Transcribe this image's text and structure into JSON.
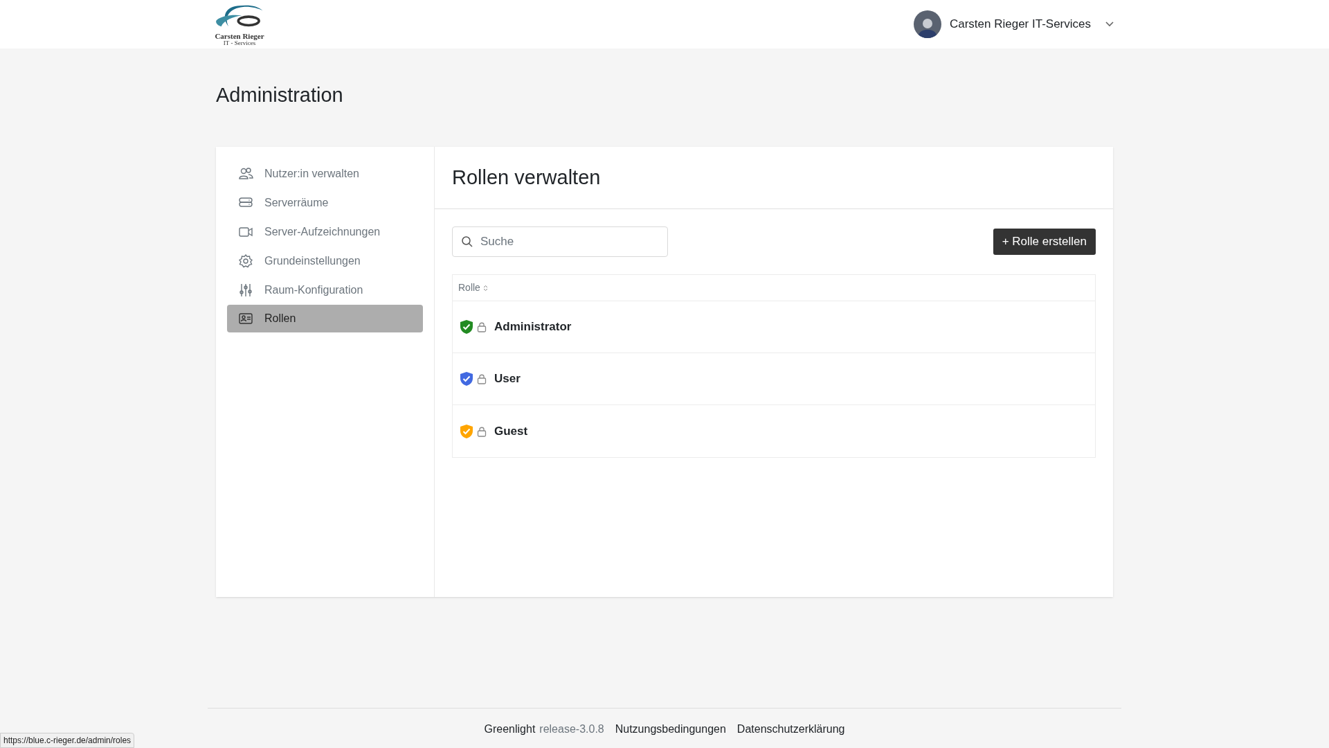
{
  "header": {
    "logo_name": "Carsten Rieger",
    "logo_sub": "IT - Services",
    "user_name": "Carsten Rieger IT-Services"
  },
  "page_title": "Administration",
  "sidebar": {
    "items": [
      {
        "label": "Nutzer:in verwalten",
        "kind": "users",
        "selected": false
      },
      {
        "label": "Serverräume",
        "kind": "server",
        "selected": false
      },
      {
        "label": "Server-Aufzeichnungen",
        "kind": "video",
        "selected": false
      },
      {
        "label": "Grundeinstellungen",
        "kind": "gear",
        "selected": false
      },
      {
        "label": "Raum-Konfiguration",
        "kind": "sliders",
        "selected": false
      },
      {
        "label": "Rollen",
        "kind": "idcard",
        "selected": true
      }
    ]
  },
  "main": {
    "title": "Rollen verwalten",
    "search": {
      "placeholder": "Suche"
    },
    "create_button": "+ Rolle erstellen",
    "table": {
      "columns": [
        "Rolle"
      ],
      "rows": [
        {
          "name": "Administrator",
          "color": "#228b22"
        },
        {
          "name": "User",
          "color": "#4169e1"
        },
        {
          "name": "Guest",
          "color": "#ffa500"
        }
      ]
    }
  },
  "footer": {
    "app": "Greenlight",
    "version": "release-3.0.8",
    "links": [
      "Nutzungsbedingungen",
      "Datenschutzerklärung"
    ]
  },
  "status_bar": {
    "url": "https://blue.c-rieger.de/admin/roles"
  }
}
